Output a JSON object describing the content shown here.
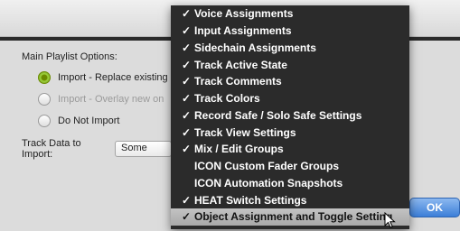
{
  "left_panel": {
    "title": "Main Playlist Options:",
    "options": [
      {
        "label": "Import - Replace existing",
        "selected": true,
        "enabled": true
      },
      {
        "label": "Import - Overlay new on",
        "selected": false,
        "enabled": false
      },
      {
        "label": "Do Not Import",
        "selected": false,
        "enabled": true
      }
    ],
    "track_data_label": "Track Data to Import:",
    "track_data_value": "Some"
  },
  "ok_button": "OK",
  "menu": {
    "items": [
      {
        "label": "Voice Assignments",
        "checked": true
      },
      {
        "label": "Input Assignments",
        "checked": true
      },
      {
        "label": "Sidechain Assignments",
        "checked": true
      },
      {
        "label": "Track Active State",
        "checked": true
      },
      {
        "label": "Track Comments",
        "checked": true
      },
      {
        "label": "Track Colors",
        "checked": true
      },
      {
        "label": "Record Safe / Solo Safe Settings",
        "checked": true
      },
      {
        "label": "Track View Settings",
        "checked": true
      },
      {
        "label": "Mix / Edit Groups",
        "checked": true
      },
      {
        "label": "ICON Custom Fader Groups",
        "checked": false
      },
      {
        "label": "ICON Automation Snapshots",
        "checked": false
      },
      {
        "label": "HEAT Switch Settings",
        "checked": true
      },
      {
        "label": "Object Assignment and Toggle Setting",
        "checked": true
      }
    ],
    "highlighted_index": 12
  },
  "checkmark_glyph": "✓",
  "colors": {
    "menu_bg": "#2b2b2b",
    "highlight_bg": "#b6b6b6",
    "ok_blue": "#3c7fd8",
    "radio_green": "#7aa52b"
  }
}
